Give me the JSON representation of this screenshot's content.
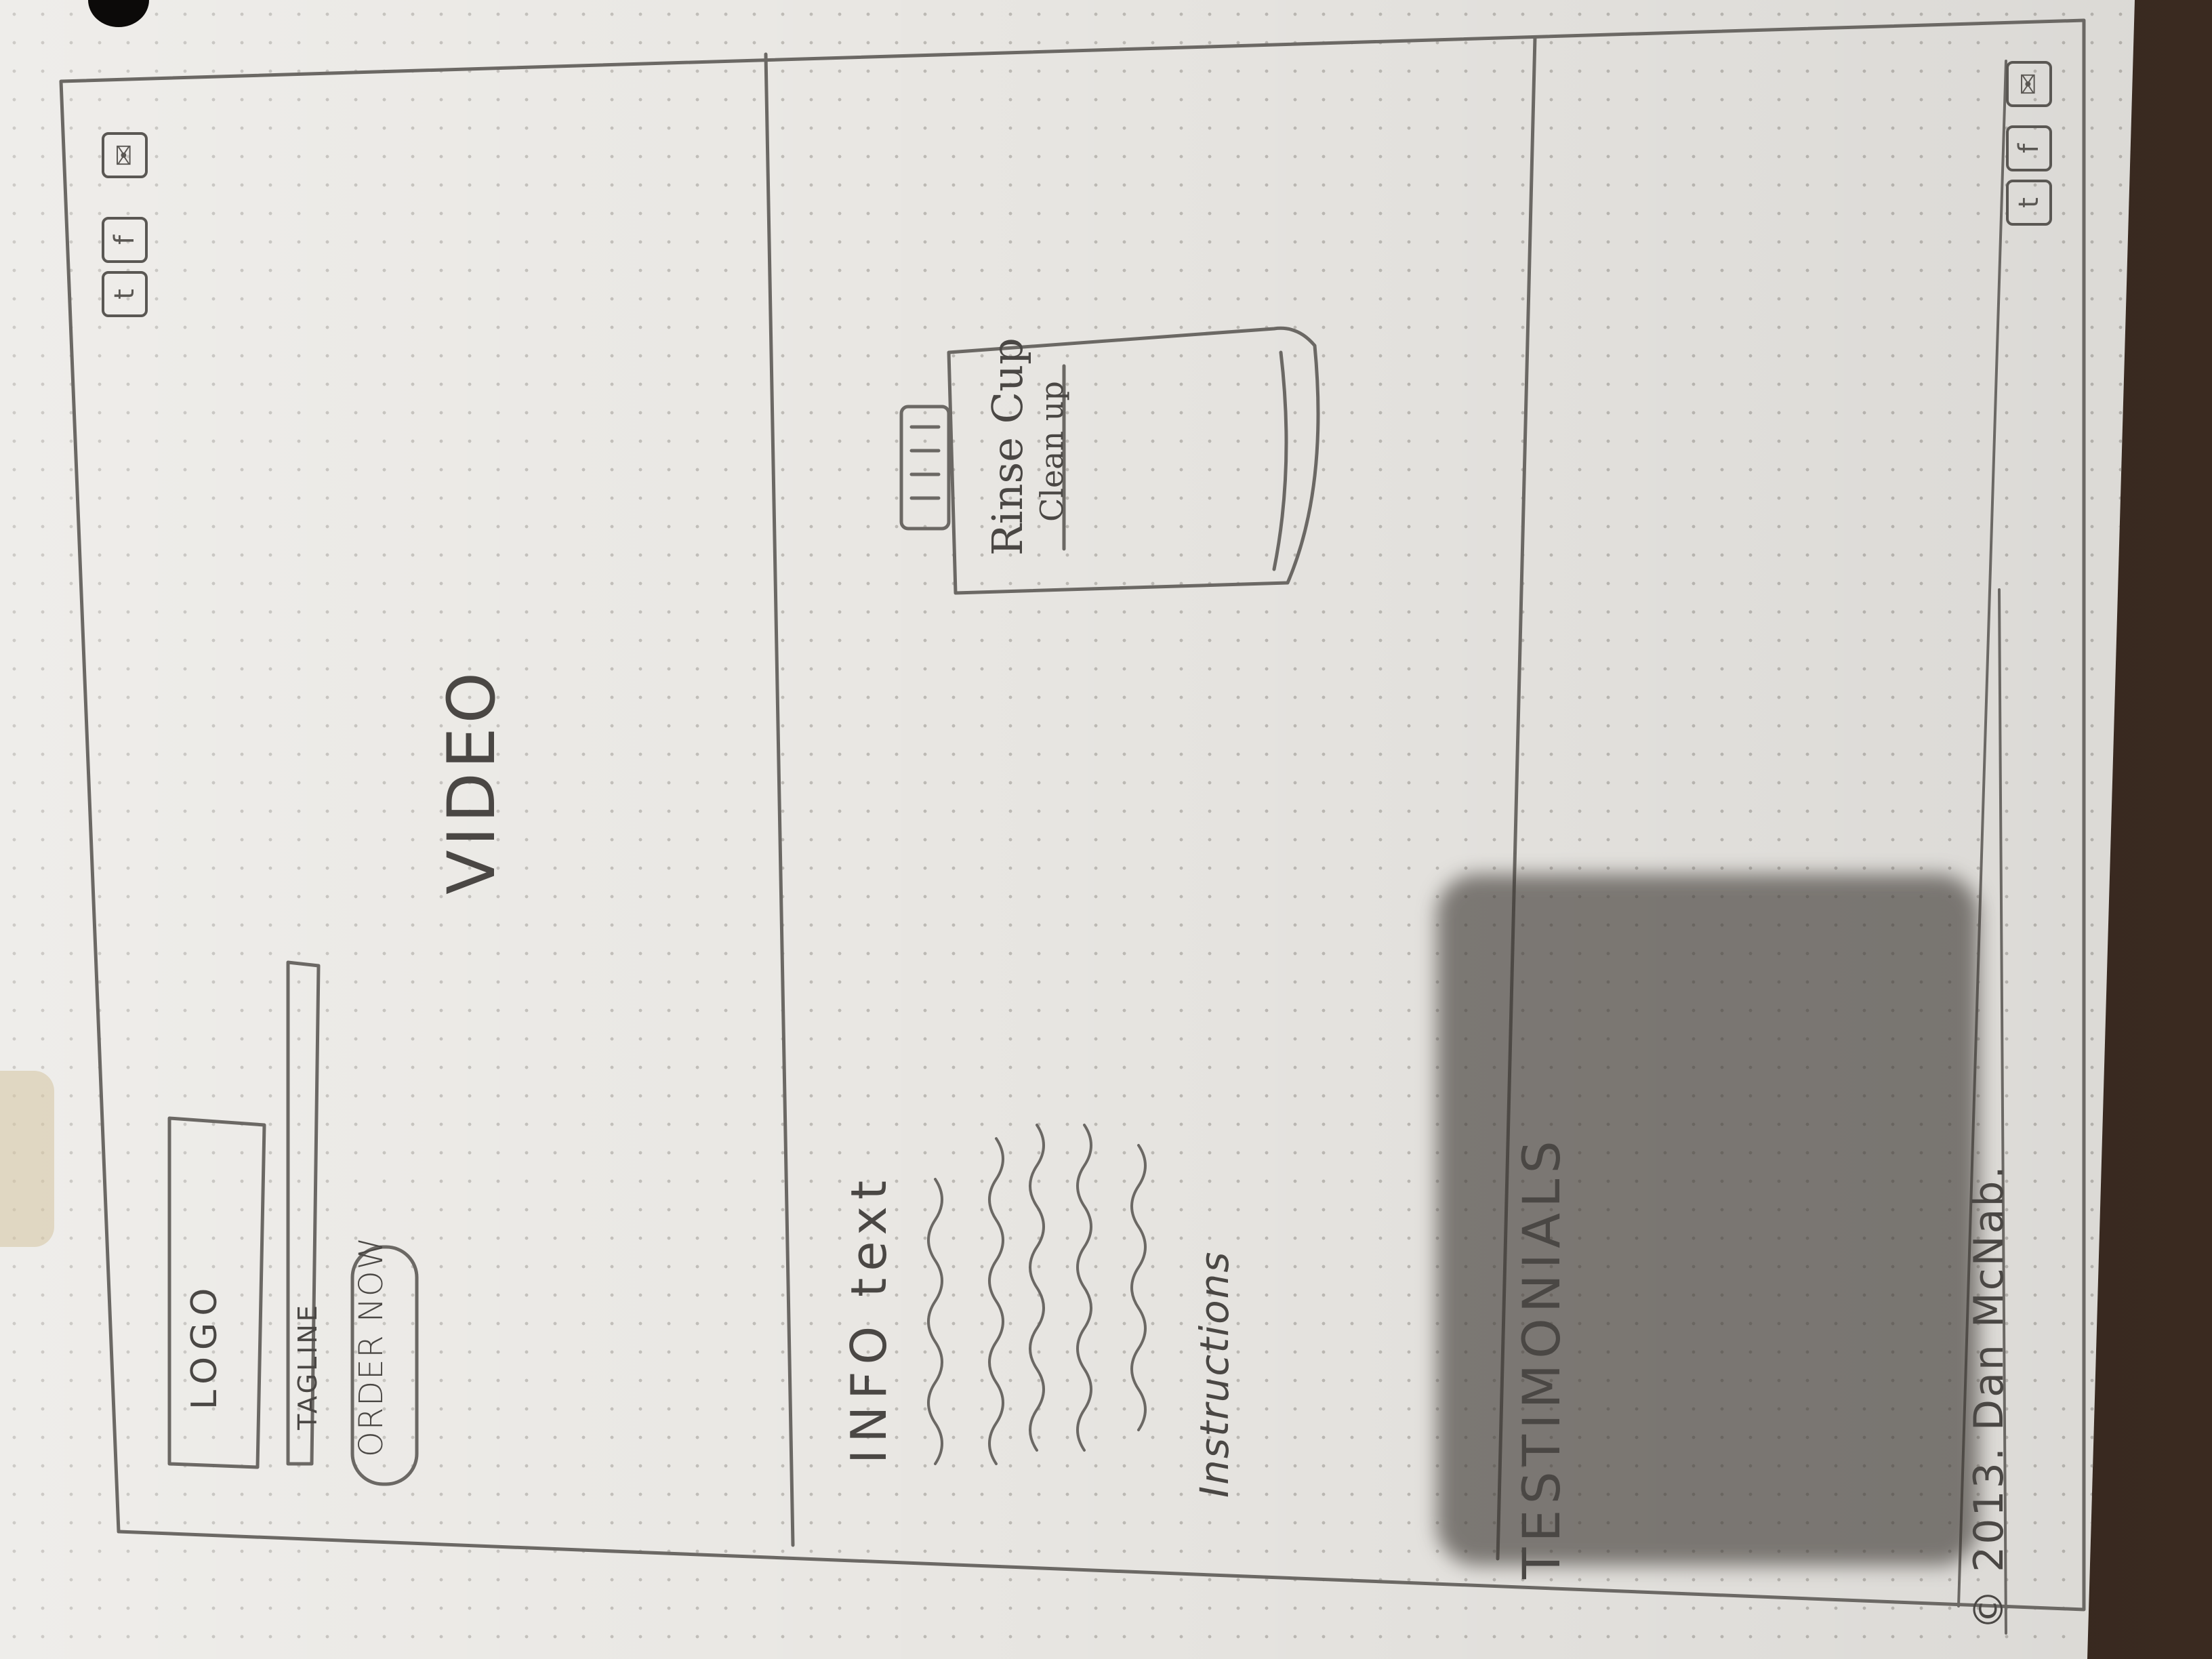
{
  "header": {
    "logo_label": "LOGO",
    "tagline_label": "TAGLINE",
    "order_button_label": "ORDER NOW",
    "video_label": "VIDEO",
    "social_icons": [
      {
        "icon": "twitter-icon",
        "glyph": "t"
      },
      {
        "icon": "facebook-icon",
        "glyph": "f"
      },
      {
        "icon": "email-icon",
        "glyph": "✉"
      }
    ]
  },
  "info": {
    "title": "INFO text",
    "instructions_label": "Instructions",
    "product_label": "Rinse Cup",
    "product_sublabel": "Clean up"
  },
  "testimonials": {
    "title": "TESTIMONIALS"
  },
  "footer": {
    "copyright": "© 2013. Dan McNab.",
    "social_icons": [
      {
        "icon": "twitter-icon",
        "glyph": "t"
      },
      {
        "icon": "facebook-icon",
        "glyph": "f"
      },
      {
        "icon": "email-icon",
        "glyph": "✉"
      }
    ]
  }
}
